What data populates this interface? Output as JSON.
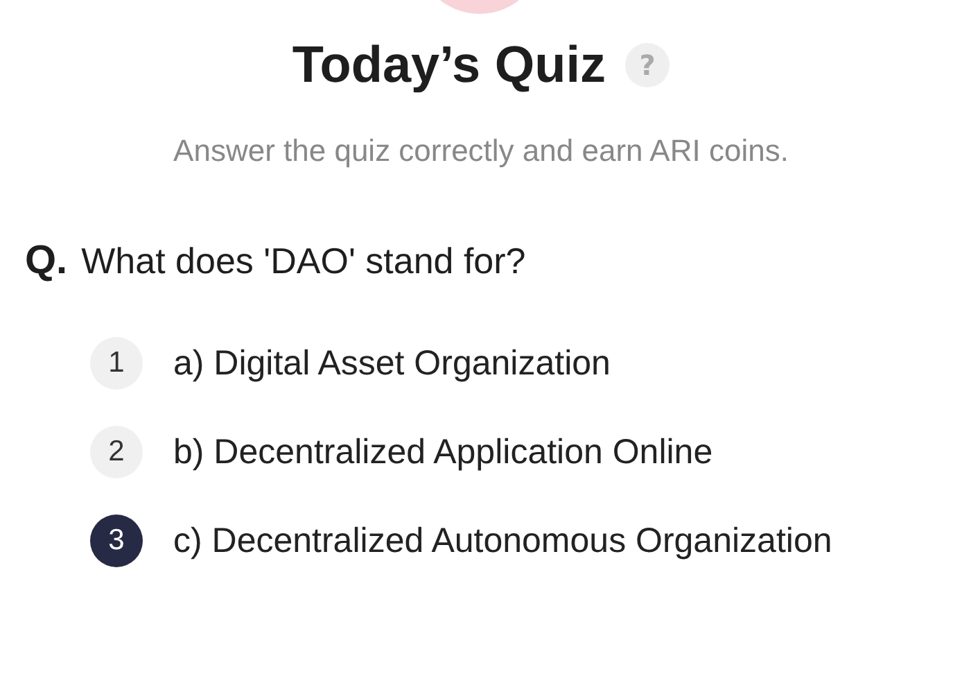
{
  "title": "Today’s Quiz",
  "help_icon": "?",
  "subtitle": "Answer the quiz correctly and earn ARI coins.",
  "question": {
    "prefix": "Q.",
    "text": "What does 'DAO' stand for?"
  },
  "options": [
    {
      "number": "1",
      "text": "a) Digital Asset Organization",
      "selected": false
    },
    {
      "number": "2",
      "text": "b) Decentralized Application Online",
      "selected": false
    },
    {
      "number": "3",
      "text": "c) Decentralized Autonomous Organization",
      "selected": true
    }
  ]
}
